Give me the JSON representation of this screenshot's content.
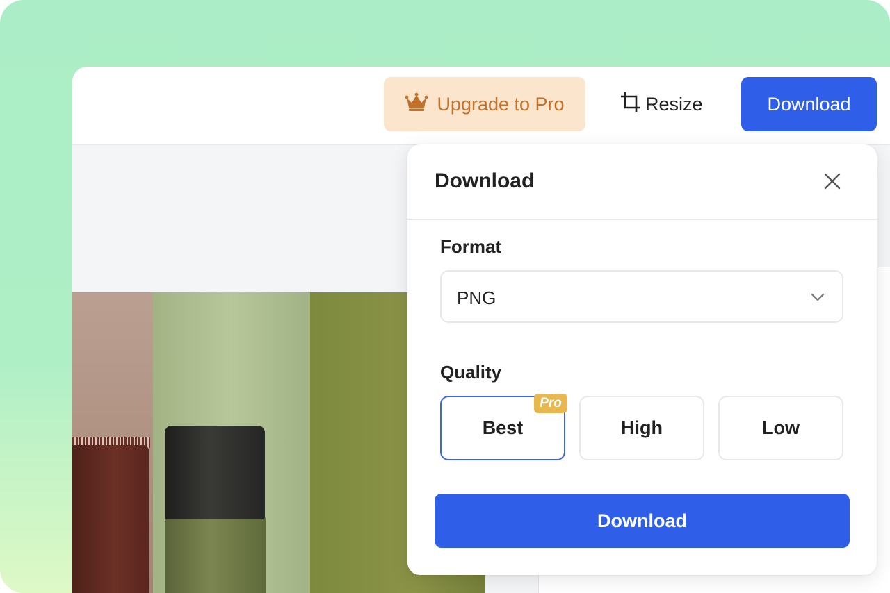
{
  "colors": {
    "accent": "#2f5fe8",
    "upgrade_bg": "#fbe6cd",
    "upgrade_text": "#c2702a",
    "pro_badge": "#e8b74d",
    "selected_border": "#3c66e6"
  },
  "toolbar": {
    "upgrade_label": "Upgrade to Pro",
    "upgrade_icon": "crown-icon",
    "resize_label": "Resize",
    "resize_icon": "crop-icon",
    "download_label": "Download"
  },
  "download_dialog": {
    "title": "Download",
    "close_icon": "close-icon",
    "format": {
      "label": "Format",
      "selected": "PNG",
      "icon": "chevron-down-icon"
    },
    "quality": {
      "label": "Quality",
      "options": [
        {
          "label": "Best",
          "badge": "Pro",
          "selected": true
        },
        {
          "label": "High",
          "selected": false
        },
        {
          "label": "Low",
          "selected": false
        }
      ]
    },
    "download_label": "Download"
  }
}
